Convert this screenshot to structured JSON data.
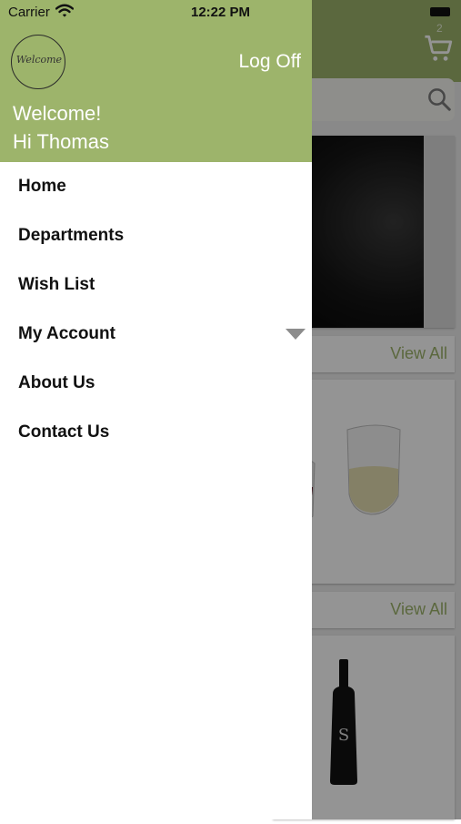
{
  "status_bar": {
    "carrier": "Carrier",
    "time": "12:22 PM"
  },
  "drawer": {
    "logo_text": "Welcome",
    "log_off": "Log Off",
    "welcome": "Welcome!",
    "greeting": "Hi Thomas",
    "menu": [
      {
        "label": "Home"
      },
      {
        "label": "Departments"
      },
      {
        "label": "Wish List"
      },
      {
        "label": "My Account",
        "expandable": true
      },
      {
        "label": "About Us"
      },
      {
        "label": "Contact Us"
      }
    ]
  },
  "background": {
    "cart_count": "2",
    "view_all_1": "View All",
    "view_all_2": "View All"
  },
  "colors": {
    "brand_green": "#9db46b",
    "menu_text": "#111111",
    "dim_overlay": "rgba(0,0,0,0.42)"
  },
  "icons": [
    "wifi-icon",
    "search-icon",
    "cart-icon",
    "chevron-down-icon",
    "battery-icon"
  ]
}
